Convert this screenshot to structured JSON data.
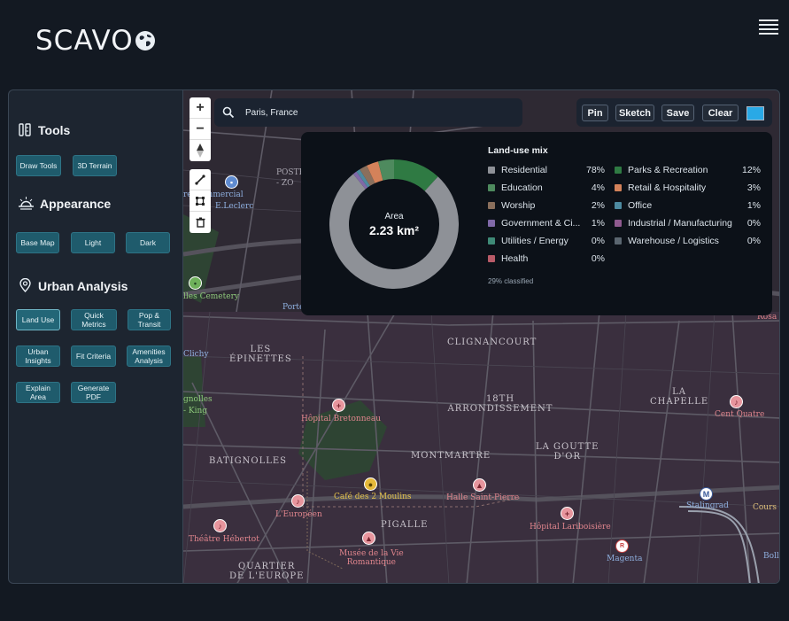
{
  "brand": {
    "name": "SCAVO"
  },
  "sidebar": {
    "tools": {
      "title": "Tools",
      "buttons": [
        "Draw Tools",
        "3D Terrain"
      ]
    },
    "appearance": {
      "title": "Appearance",
      "buttons": [
        "Base Map",
        "Light",
        "Dark"
      ]
    },
    "urban": {
      "title": "Urban Analysis",
      "buttons": [
        "Land Use",
        "Quick Metrics",
        "Pop & Transit",
        "Urban Insights",
        "Fit Criteria",
        "Amenities Analysis",
        "Explain Area",
        "Generate PDF"
      ]
    }
  },
  "search": {
    "value": "Paris, France"
  },
  "toolbar": {
    "pin": "Pin",
    "sketch": "Sketch",
    "save": "Save",
    "clear": "Clear",
    "swatch_color": "#29a9e6"
  },
  "panel": {
    "area_label": "Area",
    "area_value": "2.23 km²",
    "legend_title": "Land-use mix",
    "classified": "29% classified",
    "categories": [
      {
        "name": "Residential",
        "pct": "78%",
        "color": "#8e9197"
      },
      {
        "name": "Parks & Recreation",
        "pct": "12%",
        "color": "#2f7a43"
      },
      {
        "name": "Education",
        "pct": "4%",
        "color": "#4e8a5e"
      },
      {
        "name": "Retail & Hospitality",
        "pct": "3%",
        "color": "#d4825a"
      },
      {
        "name": "Worship",
        "pct": "2%",
        "color": "#8a6f5c"
      },
      {
        "name": "Office",
        "pct": "1%",
        "color": "#4d8aa0"
      },
      {
        "name": "Government & Ci...",
        "pct": "1%",
        "color": "#8069a8"
      },
      {
        "name": "Industrial / Manufacturing",
        "pct": "0%",
        "color": "#8f5a8f"
      },
      {
        "name": "Utilities / Energy",
        "pct": "0%",
        "color": "#3f8a77"
      },
      {
        "name": "Warehouse / Logistics",
        "pct": "0%",
        "color": "#5b6670"
      },
      {
        "name": "Health",
        "pct": "0%",
        "color": "#b95b68"
      }
    ]
  },
  "map": {
    "labels": [
      "LES ÉPINETTES",
      "CLIGNANCOURT",
      "18TH ARRONDISSEMENT",
      "LA CHAPELLE",
      "BATIGNOLLES",
      "MONTMARTRE",
      "LA GOUTTE D'OR",
      "PIGALLE",
      "QUARTIER DE L'EUROPE"
    ],
    "pois": [
      "Hôpital Bretonneau",
      "Café des 2 Moulins",
      "Halle Saint-Pierre",
      "Hôpital Lariboisière",
      "Cent Quatre",
      "L'Européen",
      "Théâtre Hébertot",
      "Musée de la Vie Romantique",
      "Stalingrad",
      "Magenta",
      "Cours F",
      "Bolli",
      "Rosa P",
      "Clichy",
      "Porte",
      "re Commercial",
      "E.Leclerc",
      "- ZO",
      "POSTE",
      "lles Cemetery",
      "gnolles",
      "- King"
    ]
  }
}
